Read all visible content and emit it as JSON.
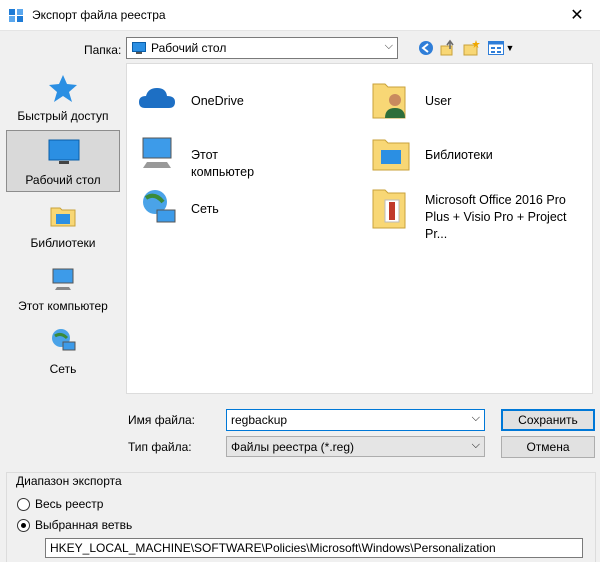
{
  "window": {
    "title": "Экспорт файла реестра",
    "close_icon": "close-icon"
  },
  "toolbar": {
    "folder_label": "Папка:",
    "folder_value": "Рабочий стол",
    "buttons": [
      "back-icon",
      "up-folder-icon",
      "new-folder-icon",
      "view-menu-icon"
    ]
  },
  "places": [
    {
      "label": "Быстрый доступ",
      "icon": "star-icon"
    },
    {
      "label": "Рабочий стол",
      "icon": "desktop-icon",
      "selected": true
    },
    {
      "label": "Библиотеки",
      "icon": "libraries-icon"
    },
    {
      "label": "Этот компьютер",
      "icon": "computer-icon"
    },
    {
      "label": "Сеть",
      "icon": "network-icon"
    }
  ],
  "files": [
    {
      "label": "OneDrive",
      "icon": "cloud-icon"
    },
    {
      "label": "User",
      "icon": "user-folder-icon"
    },
    {
      "label": "Этот компьютер",
      "icon": "computer-icon"
    },
    {
      "label": "Библиотеки",
      "icon": "libraries-icon"
    },
    {
      "label": "Сеть",
      "icon": "network-icon"
    },
    {
      "label_line1": "Microsoft Office 2016 Pro",
      "label_line2": "Plus + Visio Pro + Project Pr...",
      "icon": "shortcut-folder-icon"
    }
  ],
  "form": {
    "filename_label": "Имя файла:",
    "filename_value": "regbackup",
    "filetype_label": "Тип файла:",
    "filetype_value": "Файлы реестра (*.reg)",
    "save_label": "Сохранить",
    "cancel_label": "Отмена"
  },
  "export_range": {
    "title": "Диапазон экспорта",
    "option_all": "Весь реестр",
    "option_branch": "Выбранная ветвь",
    "selected": "branch",
    "branch_path": "HKEY_LOCAL_MACHINE\\SOFTWARE\\Policies\\Microsoft\\Windows\\Personalization"
  },
  "colors": {
    "accent": "#0078d7",
    "folder": "#f8d775",
    "window_bg": "#f0f0f0"
  }
}
